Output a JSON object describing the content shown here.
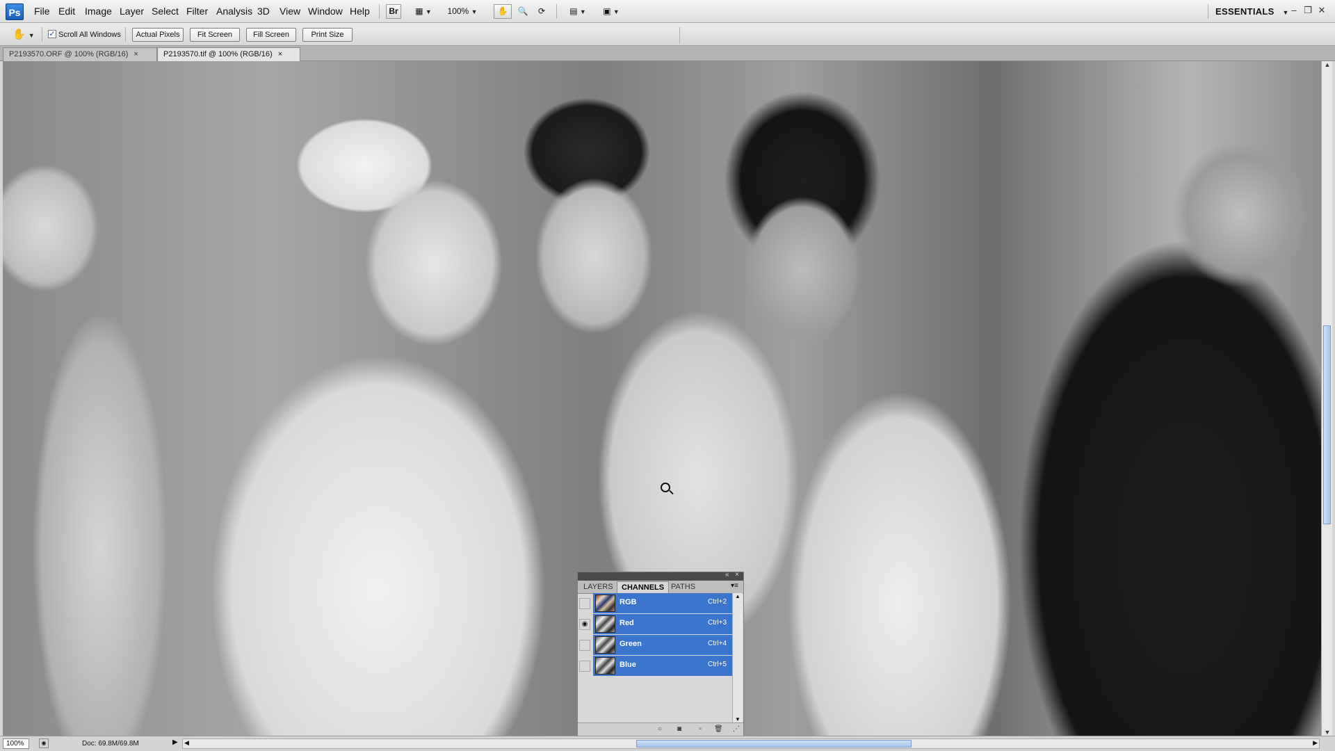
{
  "app": {
    "logo": "Ps",
    "workspace": "ESSENTIALS"
  },
  "menu": [
    "File",
    "Edit",
    "Image",
    "Layer",
    "Select",
    "Filter",
    "Analysis",
    "3D",
    "View",
    "Window",
    "Help"
  ],
  "appbar": {
    "bridge_label": "Br",
    "zoom_value": "100%"
  },
  "options": {
    "scroll_all_windows_label": "Scroll All Windows",
    "scroll_all_windows_checked": "✓",
    "actual_pixels": "Actual Pixels",
    "fit_screen": "Fit Screen",
    "fill_screen": "Fill Screen",
    "print_size": "Print Size"
  },
  "doc_tabs": [
    {
      "label": "P2193570.ORF @ 100% (RGB/16)",
      "close": "×"
    },
    {
      "label": "P2193570.tif @ 100% (RGB/16)",
      "close": "×"
    }
  ],
  "status": {
    "zoom": "100%",
    "doc_info": "Doc: 69.8M/69.8M"
  },
  "channels_panel": {
    "tabs": [
      "LAYERS",
      "CHANNELS",
      "PATHS"
    ],
    "active_tab": "CHANNELS",
    "channels": [
      {
        "name": "RGB",
        "shortcut": "Ctrl+2",
        "visible": false
      },
      {
        "name": "Red",
        "shortcut": "Ctrl+3",
        "visible": true
      },
      {
        "name": "Green",
        "shortcut": "Ctrl+4",
        "visible": false
      },
      {
        "name": "Blue",
        "shortcut": "Ctrl+5",
        "visible": false
      }
    ]
  },
  "colors": {
    "selection_blue": "#3a74cc",
    "ps_blue": "#1b5fb8"
  }
}
